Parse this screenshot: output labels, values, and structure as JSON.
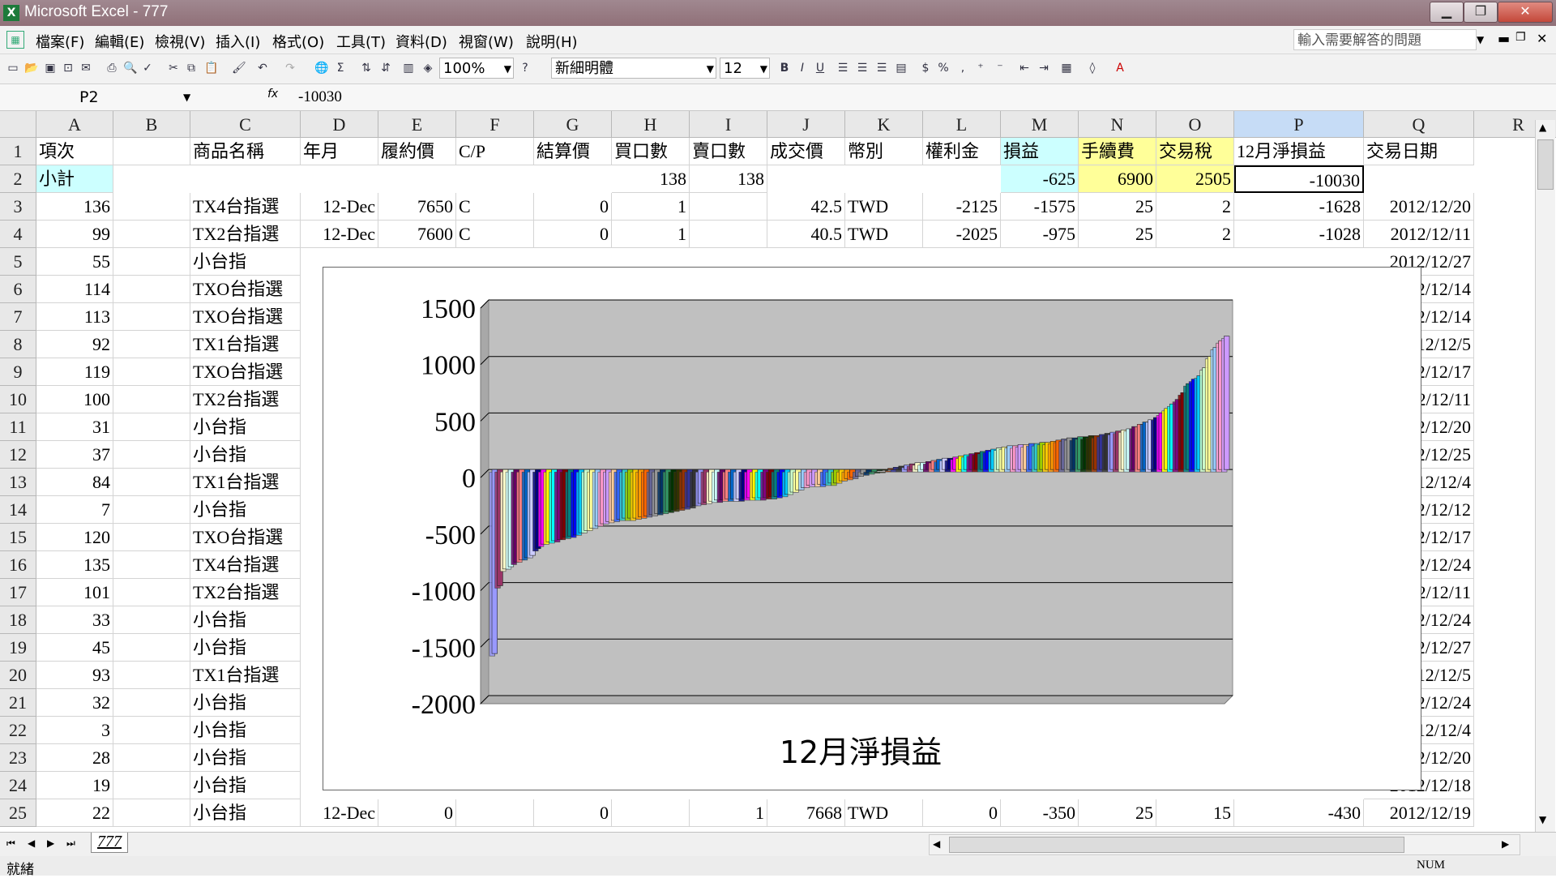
{
  "window": {
    "title": "Microsoft Excel - 777"
  },
  "menu": [
    "檔案(F)",
    "編輯(E)",
    "檢視(V)",
    "插入(I)",
    "格式(O)",
    "工具(T)",
    "資料(D)",
    "視窗(W)",
    "說明(H)"
  ],
  "help_placeholder": "輸入需要解答的問題",
  "toolbar": {
    "zoom": "100%",
    "font": "新細明體",
    "font_size": "12"
  },
  "formula": {
    "cell_ref": "P2",
    "value": "-10030"
  },
  "columns": [
    "A",
    "B",
    "C",
    "D",
    "E",
    "F",
    "G",
    "H",
    "I",
    "J",
    "K",
    "L",
    "M",
    "N",
    "O",
    "P",
    "Q",
    "R"
  ],
  "headers": [
    "項次",
    "",
    "商品名稱",
    "年月",
    "履約價",
    "C/P",
    "結算價",
    "買口數",
    "賣口數",
    "成交價",
    "幣別",
    "權利金",
    "損益",
    "手續費",
    "交易稅",
    "12月淨損益",
    "交易日期"
  ],
  "subtotal": {
    "label": "小計",
    "buy": "138",
    "sell": "138",
    "pnl": "-625",
    "fee": "6900",
    "tax": "2505",
    "net": "-10030"
  },
  "rows": [
    {
      "n": "3",
      "a": "136",
      "c": "TX4台指選",
      "d": "12-Dec",
      "e": "7650",
      "f": "C",
      "g": "0",
      "h": "1",
      "i": "",
      "j": "42.5",
      "k": "TWD",
      "l": "-2125",
      "m": "-1575",
      "nn": "25",
      "o": "2",
      "p": "-1628",
      "q": "2012/12/20"
    },
    {
      "n": "4",
      "a": "99",
      "c": "TX2台指選",
      "d": "12-Dec",
      "e": "7600",
      "f": "C",
      "g": "0",
      "h": "1",
      "i": "",
      "j": "40.5",
      "k": "TWD",
      "l": "-2025",
      "m": "-975",
      "nn": "25",
      "o": "2",
      "p": "-1028",
      "q": "2012/12/11"
    },
    {
      "n": "5",
      "a": "55",
      "c": "小台指",
      "q": "2012/12/27"
    },
    {
      "n": "6",
      "a": "114",
      "c": "TXO台指選",
      "q": "2/12/14"
    },
    {
      "n": "7",
      "a": "113",
      "c": "TXO台指選",
      "q": "2/12/14"
    },
    {
      "n": "8",
      "a": "92",
      "c": "TX1台指選",
      "q": "12/12/5"
    },
    {
      "n": "9",
      "a": "119",
      "c": "TXO台指選",
      "q": "2/12/17"
    },
    {
      "n": "10",
      "a": "100",
      "c": "TX2台指選",
      "q": "2/12/11"
    },
    {
      "n": "11",
      "a": "31",
      "c": "小台指",
      "q": "2/12/20"
    },
    {
      "n": "12",
      "a": "37",
      "c": "小台指",
      "q": "2/12/25"
    },
    {
      "n": "13",
      "a": "84",
      "c": "TX1台指選",
      "q": "12/12/4"
    },
    {
      "n": "14",
      "a": "7",
      "c": "小台指",
      "q": "2/12/12"
    },
    {
      "n": "15",
      "a": "120",
      "c": "TXO台指選",
      "q": "2/12/17"
    },
    {
      "n": "16",
      "a": "135",
      "c": "TX4台指選",
      "q": "2/12/24"
    },
    {
      "n": "17",
      "a": "101",
      "c": "TX2台指選",
      "q": "2/12/11"
    },
    {
      "n": "18",
      "a": "33",
      "c": "小台指",
      "q": "2/12/24"
    },
    {
      "n": "19",
      "a": "45",
      "c": "小台指",
      "q": "2/12/27"
    },
    {
      "n": "20",
      "a": "93",
      "c": "TX1台指選",
      "q": "12/12/5"
    },
    {
      "n": "21",
      "a": "32",
      "c": "小台指",
      "q": "2/12/24"
    },
    {
      "n": "22",
      "a": "3",
      "c": "小台指",
      "q": "12/12/4"
    },
    {
      "n": "23",
      "a": "28",
      "c": "小台指",
      "q": "2/12/20"
    },
    {
      "n": "24",
      "a": "19",
      "c": "小台指",
      "q": "2012/12/18"
    },
    {
      "n": "25",
      "a": "22",
      "c": "小台指",
      "d": "12-Dec",
      "e": "0",
      "f": "",
      "g": "0",
      "h": "",
      "i": "1",
      "j": "7668",
      "k": "TWD",
      "l": "0",
      "m": "-350",
      "nn": "25",
      "o": "15",
      "p": "-430",
      "q": "2012/12/19"
    }
  ],
  "sheet_tab": "777",
  "status": {
    "ready": "就緒",
    "num": "NUM"
  },
  "colors": {
    "subtotal_cyan": "#ccffff",
    "subtotal_yellow": "#ffff99",
    "plot_bg": "#c0c0c0"
  },
  "chart_data": {
    "type": "bar",
    "title": "12月淨損益",
    "ylim": [
      -2000,
      1500
    ],
    "yticks": [
      "1500",
      "1000",
      "500",
      "0",
      "-500",
      "-1000",
      "-1500",
      "-2000"
    ],
    "values": [
      -1628,
      -1028,
      -880,
      -860,
      -820,
      -800,
      -780,
      -760,
      -700,
      -660,
      -640,
      -630,
      -620,
      -600,
      -590,
      -580,
      -560,
      -540,
      -520,
      -500,
      -480,
      -460,
      -450,
      -440,
      -430,
      -430,
      -430,
      -420,
      -410,
      -400,
      -390,
      -380,
      -370,
      -360,
      -350,
      -340,
      -330,
      -320,
      -300,
      -290,
      -280,
      -270,
      -270,
      -260,
      -260,
      -260,
      -260,
      -250,
      -250,
      -250,
      -250,
      -240,
      -240,
      -230,
      -220,
      -200,
      -180,
      -160,
      -140,
      -130,
      -130,
      -130,
      -120,
      -120,
      -100,
      -80,
      -70,
      -60,
      -40,
      -30,
      -20,
      -10,
      0,
      10,
      20,
      30,
      40,
      50,
      60,
      60,
      70,
      80,
      90,
      100,
      100,
      110,
      120,
      130,
      140,
      150,
      160,
      170,
      180,
      190,
      200,
      210,
      210,
      220,
      220,
      230,
      230,
      240,
      240,
      250,
      260,
      270,
      280,
      280,
      290,
      290,
      300,
      300,
      310,
      320,
      330,
      340,
      350,
      360,
      380,
      400,
      420,
      440,
      460,
      500,
      540,
      580,
      620,
      680,
      760,
      800,
      830,
      900,
      1000,
      1080,
      1140,
      1180
    ]
  }
}
